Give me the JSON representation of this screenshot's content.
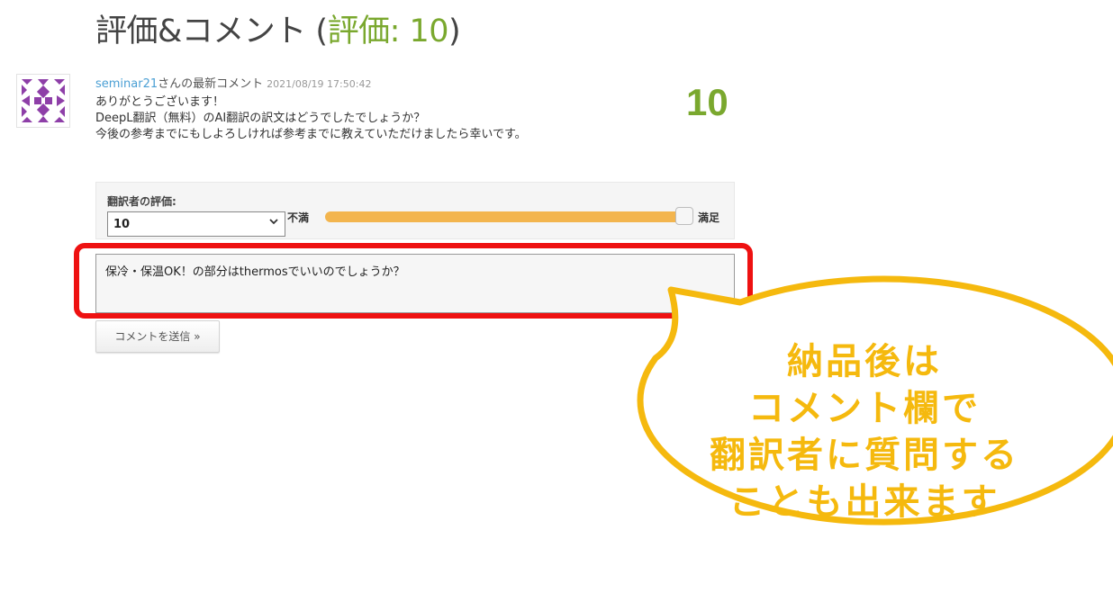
{
  "header": {
    "title": "評価&コメント",
    "rating_prefix": "評価: ",
    "rating_value": "10"
  },
  "comment": {
    "username": "seminar21",
    "username_suffix": "さんの最新コメント",
    "date": "2021/08/19 17:50:42",
    "lines": [
      "ありがとうございます！",
      "DeepL翻訳（無料）のAI翻訳の訳文はどうでしたでしょうか？",
      "今後の参考までにもしよろしければ参考までに教えていただけましたら幸いです。"
    ],
    "score": "10"
  },
  "rating_form": {
    "label": "翻訳者の評価:",
    "selected": "10",
    "min_label": "不満",
    "max_label": "満足",
    "slider_fraction": 1.0
  },
  "comment_form": {
    "value": "保冷・保温OK！の部分はthermosでいいのでしょうか？",
    "submit_label": "コメントを送信 »"
  },
  "callout": {
    "lines": [
      "納品後は",
      "コメント欄で",
      "翻訳者に質問する",
      "ことも出来ます"
    ]
  },
  "colors": {
    "accent_green": "#7aa82e",
    "username_blue": "#4a9fd4",
    "slider_orange": "#f3b54e",
    "highlight_red": "#ee1111",
    "callout_yellow": "#f5b90e"
  }
}
